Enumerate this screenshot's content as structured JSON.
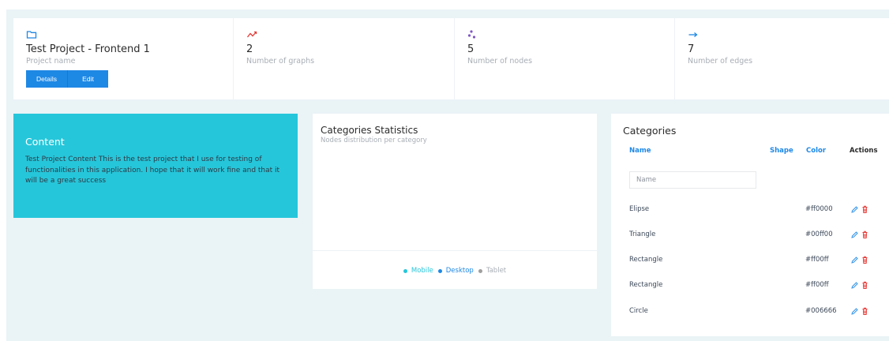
{
  "stats": [
    {
      "icon": "folder-icon",
      "value": "Test Project - Frontend 1",
      "label": "Project name"
    },
    {
      "icon": "trend-line-icon",
      "value": "2",
      "label": "Number of graphs"
    },
    {
      "icon": "nodes-icon",
      "value": "5",
      "label": "Number of nodes"
    },
    {
      "icon": "arrow-right-icon",
      "value": "7",
      "label": "Number of edges"
    }
  ],
  "project_buttons": {
    "details": "Details",
    "edit": "Edit"
  },
  "content": {
    "title": "Content",
    "text": "Test Project Content This is the test project that I use for testing of functionalities in this application. I hope that it will work fine and that it will be a great success"
  },
  "chart": {
    "title": "Categories Statistics",
    "subtitle": "Nodes distribution per category",
    "legend": [
      {
        "label": "Mobile",
        "color": "#26c6da"
      },
      {
        "label": "Desktop",
        "color": "#1e88e5"
      },
      {
        "label": "Tablet",
        "color": "#9e9e9e"
      }
    ]
  },
  "chart_data": {
    "type": "pie",
    "categories": [
      "Mobile",
      "Desktop",
      "Tablet"
    ],
    "values": [],
    "title": "Categories Statistics",
    "subtitle": "Nodes distribution per category",
    "legend_position": "bottom"
  },
  "categories": {
    "title": "Categories",
    "columns": {
      "name": "Name",
      "shape": "Shape",
      "color": "Color",
      "actions": "Actions"
    },
    "name_placeholder": "Name",
    "rows": [
      {
        "name": "Elipse",
        "color": "#ff0000"
      },
      {
        "name": "Triangle",
        "color": "#00ff00"
      },
      {
        "name": "Rectangle",
        "color": "#ff00ff"
      },
      {
        "name": "Rectangle",
        "color": "#ff00ff"
      },
      {
        "name": "Circle",
        "color": "#006666"
      }
    ]
  },
  "colors": {
    "accent": "#1e88e5",
    "cyan": "#26c6da",
    "danger": "#e53935",
    "background": "#eaf3f6"
  }
}
